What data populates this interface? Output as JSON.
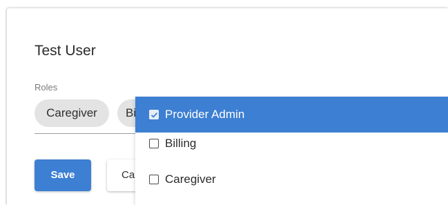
{
  "form": {
    "title": "Test User",
    "roles_label": "Roles",
    "chips": [
      {
        "label": "Caregiver"
      },
      {
        "label": "Billing"
      }
    ]
  },
  "actions": {
    "save_label": "Save",
    "cancel_label": "Cancel"
  },
  "roles_menu": {
    "items": [
      {
        "label": "Provider Admin",
        "checked": true,
        "highlighted": true
      },
      {
        "label": "Billing",
        "checked": false,
        "highlighted": false
      },
      {
        "label": "Caregiver",
        "checked": false,
        "highlighted": false
      }
    ]
  },
  "colors": {
    "accent": "#3d7fd2",
    "chip_background": "#e3e3e3"
  }
}
